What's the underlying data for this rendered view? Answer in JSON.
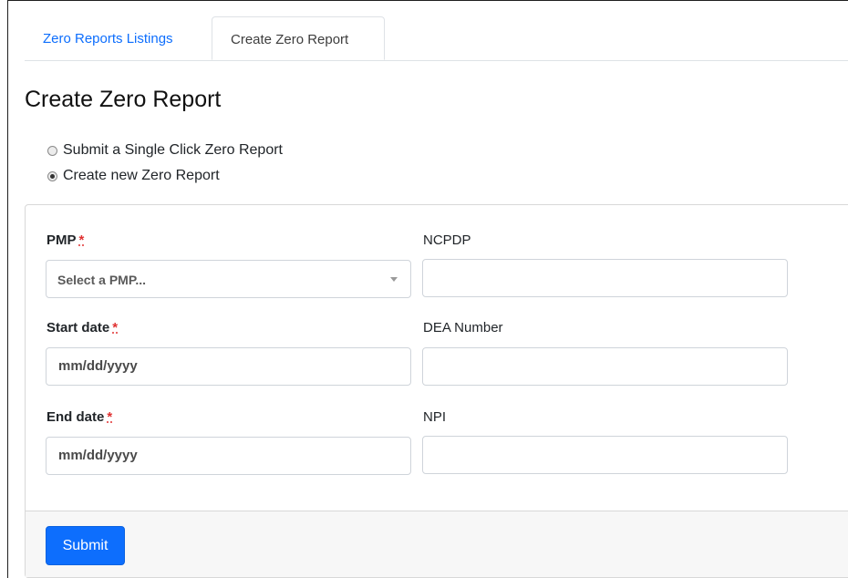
{
  "tabs": [
    {
      "label": "Zero Reports Listings",
      "active": false
    },
    {
      "label": "Create Zero Report",
      "active": true
    }
  ],
  "page_title": "Create Zero Report",
  "report_type": {
    "options": [
      {
        "label": "Submit a Single Click Zero Report",
        "checked": false
      },
      {
        "label": "Create new Zero Report",
        "checked": true
      }
    ]
  },
  "form": {
    "required_marker": "*",
    "pmp": {
      "label": "PMP",
      "placeholder": "Select a PMP..."
    },
    "ncpdp": {
      "label": "NCPDP",
      "value": ""
    },
    "start_date": {
      "label": "Start date",
      "placeholder": "mm/dd/yyyy"
    },
    "dea_number": {
      "label": "DEA Number",
      "value": ""
    },
    "end_date": {
      "label": "End date",
      "placeholder": "mm/dd/yyyy"
    },
    "npi": {
      "label": "NPI",
      "value": ""
    },
    "submit_label": "Submit"
  },
  "colors": {
    "accent": "#0d6efd",
    "required": "#e03131",
    "footer_bg": "#f7f7f7"
  }
}
